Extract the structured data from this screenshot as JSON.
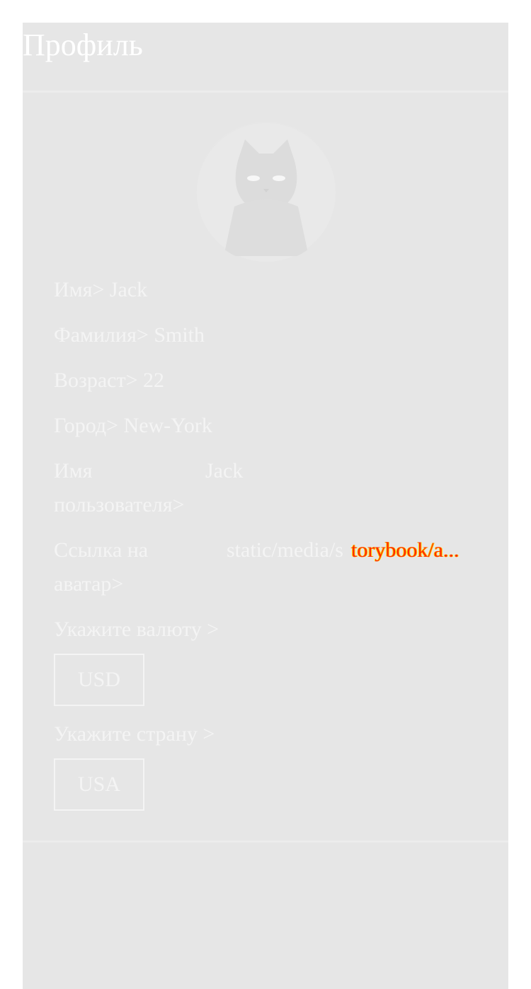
{
  "header": {
    "title": "Профиль"
  },
  "profile": {
    "avatar_icon": "cat-avatar",
    "first_name": {
      "label": "Имя>",
      "value": "Jack"
    },
    "last_name": {
      "label": "Фамилия>",
      "value": "Smith"
    },
    "age": {
      "label": "Возраст>",
      "value": "22"
    },
    "city": {
      "label": "Город>",
      "value": "New-York"
    },
    "username": {
      "label": "Имя пользователя>",
      "value": "Jack"
    },
    "avatar_link": {
      "label": "Ссылка на аватар>",
      "value": "static/media/s",
      "value_tail": "torybook/a..."
    }
  },
  "currency": {
    "label": "Укажите валюту >",
    "selected": "USD"
  },
  "country": {
    "label": "Укажите страну >",
    "selected": "USA"
  }
}
